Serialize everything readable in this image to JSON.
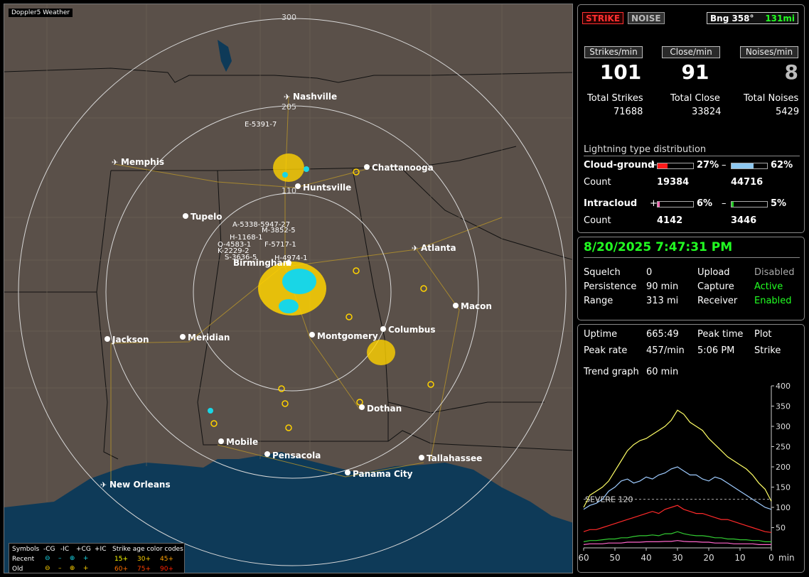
{
  "app_title": "Doppler5 Weather",
  "mode": {
    "strike": "STRIKE",
    "noise": "NOISE"
  },
  "bearing": {
    "label": "Bng 358°",
    "range": "131mi"
  },
  "rates": {
    "strikes_label": "Strikes/min",
    "strikes": "101",
    "close_label": "Close/min",
    "close": "91",
    "noises_label": "Noises/min",
    "noises": "8"
  },
  "totals": {
    "strikes_label": "Total Strikes",
    "strikes": "71688",
    "close_label": "Total Close",
    "close": "33824",
    "noises_label": "Total Noises",
    "noises": "5429"
  },
  "distribution": {
    "title": "Lightning type distribution",
    "cg_label": "Cloud-ground",
    "cg_plus_pct": "27%",
    "cg_minus_pct": "62%",
    "cg_plus_fill": 0.27,
    "cg_minus_fill": 0.62,
    "count_label": "Count",
    "cg_plus_count": "19384",
    "cg_minus_count": "44716",
    "ic_label": "Intracloud",
    "ic_plus_pct": "6%",
    "ic_minus_pct": "5%",
    "ic_plus_fill": 0.06,
    "ic_minus_fill": 0.05,
    "ic_plus_count": "4142",
    "ic_minus_count": "3446",
    "plus": "+",
    "minus": "–",
    "colors": {
      "cg_plus": "#ff1a1a",
      "cg_minus": "#8ec8f0",
      "ic_plus": "#ff69b4",
      "ic_minus": "#22cc22"
    }
  },
  "status": {
    "datetime": "8/20/2025 7:47:31 PM",
    "squelch_label": "Squelch",
    "squelch": "0",
    "persistence_label": "Persistence",
    "persistence": "90 min",
    "range_label": "Range",
    "range": "313 mi",
    "upload_label": "Upload",
    "upload": "Disabled",
    "capture_label": "Capture",
    "capture": "Active",
    "receiver_label": "Receiver",
    "receiver": "Enabled"
  },
  "stats": {
    "uptime_label": "Uptime",
    "uptime": "665:49",
    "peak_time_label": "Peak time",
    "peak_time": "5:06 PM",
    "plot_label": "Plot",
    "plot": "Strike",
    "peak_rate_label": "Peak rate",
    "peak_rate": "457/min",
    "trend_label": "Trend graph",
    "trend": "60 min"
  },
  "map": {
    "rings": [
      "300",
      "205",
      "110"
    ],
    "cities": [
      "Nashville",
      "Chattanooga",
      "Memphis",
      "Huntsville",
      "Tupelo",
      "Atlanta",
      "Birmingham",
      "Macon",
      "Columbus",
      "Montgomery",
      "Meridian",
      "Jackson",
      "Dothan",
      "Mobile",
      "Pensacola",
      "Tallahassee",
      "Panama City",
      "New Orleans"
    ],
    "airports": [
      "Nashville",
      "Memphis",
      "Atlanta",
      "New Orleans"
    ],
    "storm_labels": [
      "E-5391-7",
      "A-5338-5947-27",
      "M-3852-5",
      "H-1168-1",
      "Q-4583-1",
      "F-5717-1",
      "K-2229-2",
      "S-3636-5",
      "H-4974-1"
    ]
  },
  "legend": {
    "symbols": "Symbols",
    "cg_minus": "-CG",
    "ic_minus": "-IC",
    "cg_plus": "+CG",
    "ic_plus": "+IC",
    "age_title": "Strike age color codes",
    "recent": "Recent",
    "old": "Old",
    "ages": [
      "15+",
      "30+",
      "45+",
      "60+",
      "75+",
      "90+"
    ],
    "age_colors": [
      "#ffff00",
      "#ffd000",
      "#ffa000",
      "#ff7000",
      "#ff4000",
      "#ff2000"
    ]
  },
  "chart_data": {
    "type": "line",
    "xlabel": "min",
    "x_ticks": [
      60,
      50,
      40,
      30,
      20,
      10,
      0
    ],
    "xlim": [
      60,
      0
    ],
    "y_ticks": [
      50,
      100,
      150,
      200,
      250,
      300,
      350,
      400
    ],
    "ylim": [
      0,
      400
    ],
    "threshold": {
      "label": "SEVERE 120",
      "value": 120
    },
    "series": [
      {
        "color": "#ffff66",
        "values": [
          100,
          130,
          140,
          150,
          165,
          190,
          215,
          240,
          255,
          265,
          270,
          280,
          290,
          300,
          315,
          340,
          330,
          310,
          300,
          290,
          270,
          255,
          240,
          225,
          215,
          205,
          195,
          180,
          160,
          145,
          115
        ]
      },
      {
        "color": "#9ecbff",
        "values": [
          95,
          105,
          110,
          120,
          140,
          150,
          165,
          170,
          160,
          165,
          175,
          170,
          180,
          185,
          195,
          200,
          190,
          180,
          180,
          170,
          165,
          175,
          170,
          160,
          150,
          140,
          130,
          120,
          110,
          100,
          95
        ]
      },
      {
        "color": "#ff2a2a",
        "values": [
          40,
          45,
          45,
          50,
          55,
          60,
          65,
          70,
          75,
          80,
          85,
          90,
          85,
          95,
          100,
          105,
          95,
          90,
          85,
          85,
          80,
          75,
          70,
          70,
          65,
          60,
          55,
          50,
          45,
          40,
          38
        ]
      },
      {
        "color": "#33cc33",
        "values": [
          15,
          18,
          18,
          20,
          22,
          22,
          25,
          25,
          28,
          30,
          30,
          32,
          30,
          35,
          35,
          40,
          35,
          32,
          30,
          30,
          28,
          25,
          25,
          22,
          22,
          20,
          20,
          18,
          18,
          15,
          15
        ]
      },
      {
        "color": "#ff66cc",
        "values": [
          8,
          10,
          10,
          10,
          12,
          12,
          12,
          14,
          14,
          14,
          15,
          15,
          15,
          16,
          16,
          18,
          16,
          15,
          15,
          14,
          14,
          12,
          12,
          12,
          10,
          10,
          10,
          10,
          8,
          8,
          8
        ]
      }
    ]
  }
}
